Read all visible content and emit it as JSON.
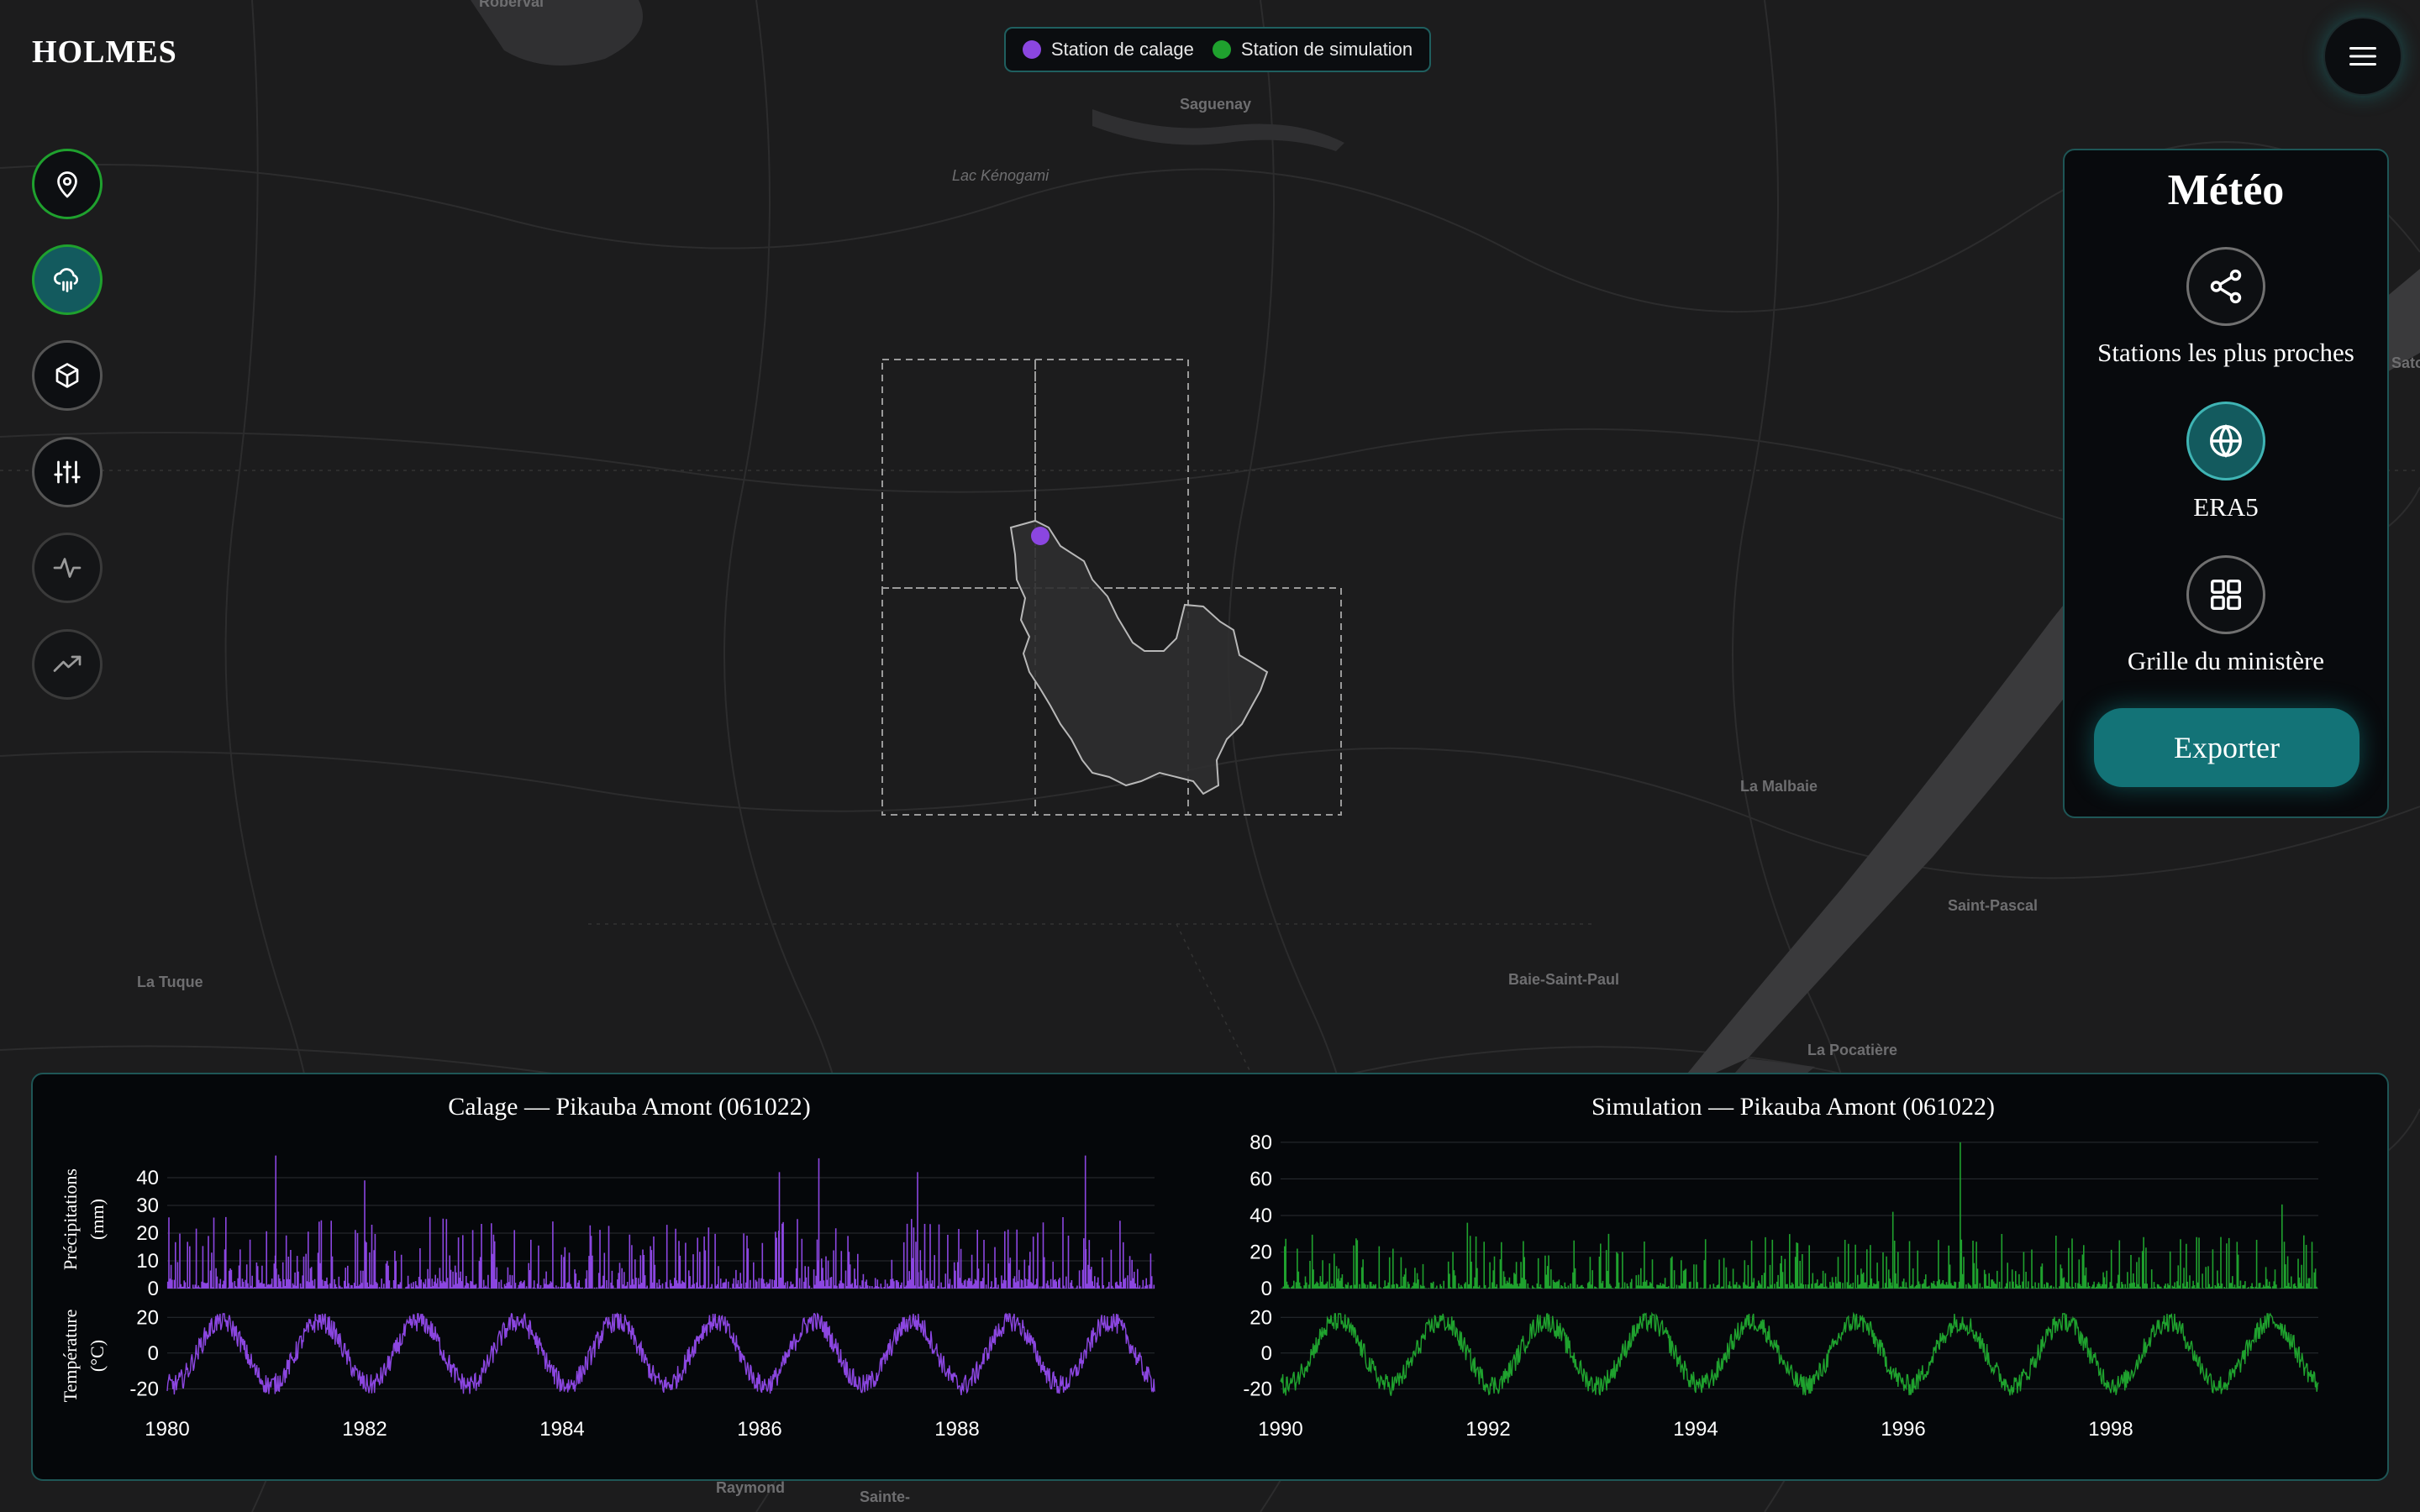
{
  "app": {
    "title": "HOLMES"
  },
  "legend": [
    {
      "label": "Station de calage",
      "color": "#8b46e0"
    },
    {
      "label": "Station de simulation",
      "color": "#1fa12e"
    }
  ],
  "sidebar": {
    "items": [
      {
        "name": "location-pin-icon"
      },
      {
        "name": "weather-cloud-icon"
      },
      {
        "name": "cube-icon"
      },
      {
        "name": "sliders-icon"
      },
      {
        "name": "activity-icon"
      },
      {
        "name": "trend-up-icon"
      }
    ]
  },
  "map_labels": {
    "roberval": "Roberval",
    "saguenay": "Saguenay",
    "lac_kenogami": "Lac Kénogami",
    "la_malbaie": "La Malbaie",
    "saint_pascal": "Saint-Pascal",
    "la_tuque": "La Tuque",
    "baie_saint_paul": "Baie-Saint-Paul",
    "la_pocatiere": "La Pocatière",
    "raymond": "Raymond",
    "sainte": "Sainte-",
    "edge_right": "Satol"
  },
  "panel": {
    "title": "Météo",
    "options": [
      {
        "label": "Stations les plus proches",
        "icon": "share-nodes-icon",
        "active": false
      },
      {
        "label": "ERA5",
        "icon": "globe-icon",
        "active": true
      },
      {
        "label": "Grille du ministère",
        "icon": "grid-icon",
        "active": false
      }
    ],
    "export_label": "Exporter"
  },
  "chart_data": [
    {
      "type": "line",
      "title": "Calage — Pikauba Amont (061022)",
      "color": "#8b46e0",
      "x_range": [
        1980,
        1990
      ],
      "x_ticks": [
        "1980",
        "1982",
        "1984",
        "1986",
        "1988"
      ],
      "panels": [
        {
          "ylabel": "Précipitations (mm)",
          "ylim": [
            0,
            50
          ],
          "yticks": [
            0,
            10,
            20,
            30,
            40
          ],
          "series_desc": "daily precipitation, mostly 0–15 mm, peaks near 48 mm",
          "peaks": [
            [
              1981.1,
              48
            ],
            [
              1982.0,
              39
            ],
            [
              1986.2,
              42
            ],
            [
              1986.6,
              47
            ],
            [
              1987.6,
              42
            ],
            [
              1989.3,
              48
            ]
          ]
        },
        {
          "ylabel": "Température (°C)",
          "ylim": [
            -25,
            22
          ],
          "yticks": [
            -20,
            0,
            20
          ],
          "seasonal": {
            "amplitude": 18,
            "mean": 0,
            "noise": 6
          }
        }
      ]
    },
    {
      "type": "line",
      "title": "Simulation — Pikauba Amont (061022)",
      "color": "#1fa12e",
      "x_range": [
        1990,
        2000
      ],
      "x_ticks": [
        "1990",
        "1992",
        "1994",
        "1996",
        "1998"
      ],
      "panels": [
        {
          "ylabel": "",
          "ylim": [
            0,
            85
          ],
          "yticks": [
            0,
            20,
            40,
            60,
            80
          ],
          "peaks": [
            [
              1991.8,
              36
            ],
            [
              1995.9,
              42
            ],
            [
              1996.55,
              80
            ],
            [
              1999.65,
              46
            ]
          ]
        },
        {
          "ylabel": "",
          "ylim": [
            -25,
            22
          ],
          "yticks": [
            -20,
            0,
            20
          ],
          "seasonal": {
            "amplitude": 18,
            "mean": 0,
            "noise": 6
          }
        }
      ]
    }
  ]
}
